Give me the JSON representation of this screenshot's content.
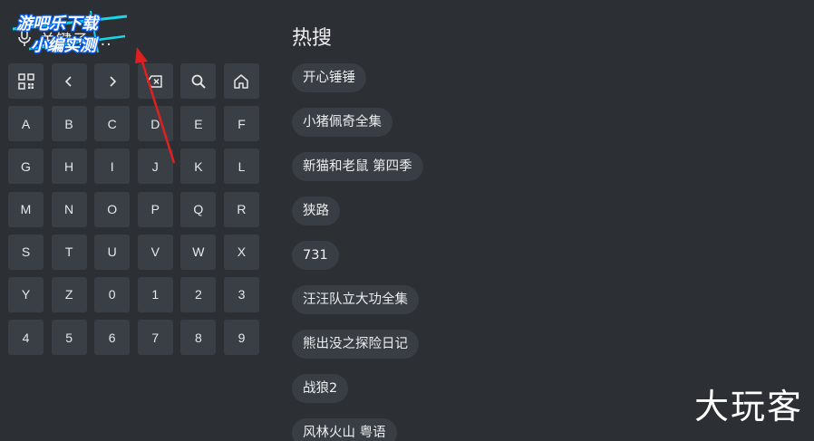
{
  "search": {
    "text": "关键子 ..."
  },
  "watermark": {
    "line1": "游吧乐下载",
    "line2": "小编实测",
    "corner": "大玩客"
  },
  "keypad": {
    "control_keys": [
      "qr-code",
      "left",
      "right",
      "backspace",
      "search",
      "home"
    ],
    "rows": [
      [
        "A",
        "B",
        "C",
        "D",
        "E",
        "F"
      ],
      [
        "G",
        "H",
        "I",
        "J",
        "K",
        "L"
      ],
      [
        "M",
        "N",
        "O",
        "P",
        "Q",
        "R"
      ],
      [
        "S",
        "T",
        "U",
        "V",
        "W",
        "X"
      ],
      [
        "Y",
        "Z",
        "0",
        "1",
        "2",
        "3"
      ],
      [
        "4",
        "5",
        "6",
        "7",
        "8",
        "9"
      ]
    ]
  },
  "hot_search": {
    "title": "热搜",
    "items": [
      "开心锤锤",
      "小猪佩奇全集",
      "新猫和老鼠 第四季",
      "狭路",
      "731",
      "汪汪队立大功全集",
      "熊出没之探险日记",
      "战狼2",
      "风林火山 粤语"
    ]
  },
  "colors": {
    "background": "#2c3035",
    "key_background": "#3a3f45",
    "chip_background": "#393e44",
    "annotation_arrow": "#e02020",
    "watermark_outline": "#0a66ff"
  }
}
